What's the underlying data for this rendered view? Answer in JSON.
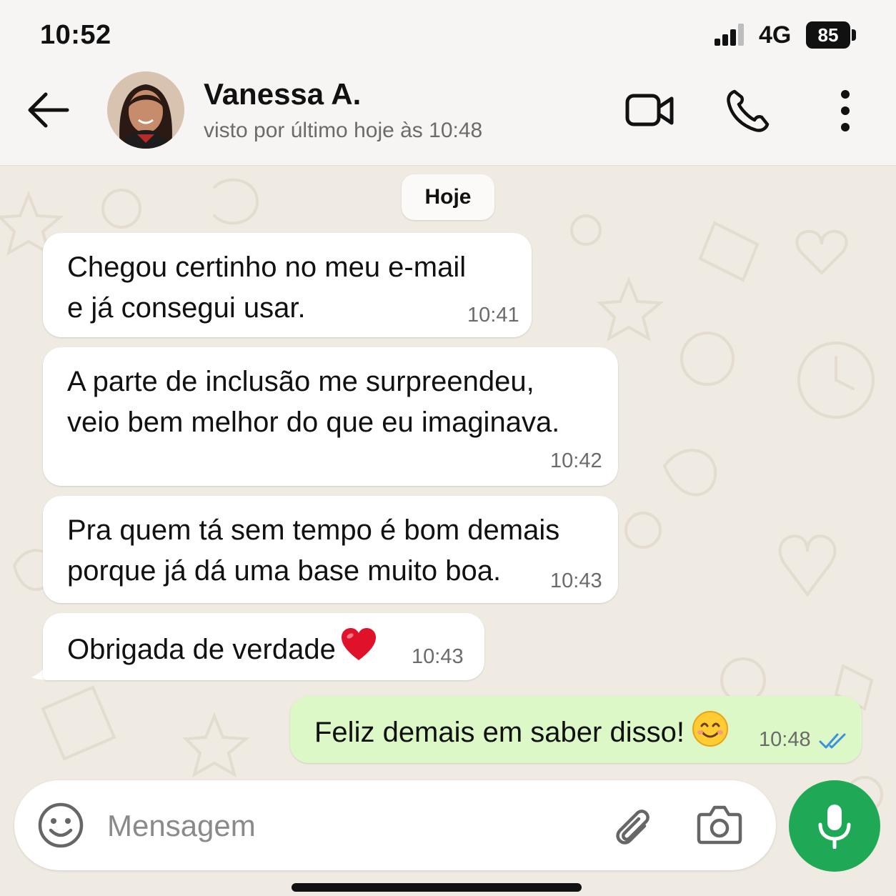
{
  "status_bar": {
    "time": "10:52",
    "network": "4G",
    "battery": "85",
    "signal_icon": "signal-icon"
  },
  "header": {
    "contact_name": "Vanessa A.",
    "last_seen": "visto por último hoje às 10:48",
    "icons": [
      "back-arrow-icon",
      "video-call-icon",
      "phone-icon",
      "more-vertical-icon"
    ]
  },
  "chat": {
    "date_label": "Hoje",
    "messages": [
      {
        "direction": "in",
        "text": "Chegou certinho no meu e-mail\ne já consegui usar.",
        "time": "10:41"
      },
      {
        "direction": "in",
        "text": "A parte de inclusão me surpreendeu,\nveio bem melhor do que eu imaginava.",
        "time": "10:42"
      },
      {
        "direction": "in",
        "text": "Pra quem tá sem tempo é bom demais\nporque já dá uma base muito boa.",
        "time": "10:43"
      },
      {
        "direction": "in",
        "text": "Obrigada de verdade",
        "emoji": "red-heart",
        "time": "10:43"
      },
      {
        "direction": "out",
        "text": "Feliz demais em saber disso!",
        "emoji": "smiling-face",
        "time": "10:48",
        "status": "read"
      }
    ]
  },
  "composer": {
    "placeholder": "Mensagem",
    "icons": [
      "emoji-icon",
      "attach-icon",
      "camera-icon",
      "mic-icon"
    ]
  },
  "colors": {
    "chat_background": "#efeae2",
    "incoming_bubble": "#ffffff",
    "outgoing_bubble": "#dcf8c6",
    "mic_button": "#1fa855",
    "read_ticks": "#3d8fe0"
  }
}
